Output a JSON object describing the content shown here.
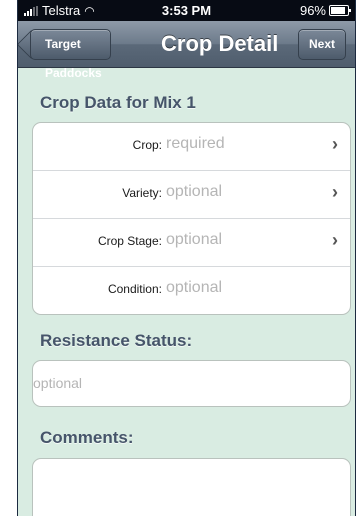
{
  "status_bar": {
    "carrier": "Telstra",
    "time": "3:53 PM",
    "battery": "96%"
  },
  "nav": {
    "back_label": "Target Paddocks",
    "title": "Crop Detail",
    "next_label": "Next"
  },
  "crop_section": {
    "title": "Crop Data for Mix 1",
    "rows": [
      {
        "label": "Crop:",
        "value": "required"
      },
      {
        "label": "Variety:",
        "value": "optional"
      },
      {
        "label": "Crop Stage:",
        "value": "optional"
      },
      {
        "label": "Condition:",
        "value": "optional"
      }
    ]
  },
  "resistance": {
    "title": "Resistance Status:",
    "placeholder": "optional"
  },
  "comments": {
    "title": "Comments:"
  },
  "colors": {
    "background": "#d9ece2",
    "section_title": "#46556a",
    "placeholder": "#b5b5b5"
  },
  "icons": {
    "chevron": "chevron-right-icon",
    "wifi": "wifi-icon",
    "signal": "signal-icon",
    "battery": "battery-icon"
  }
}
